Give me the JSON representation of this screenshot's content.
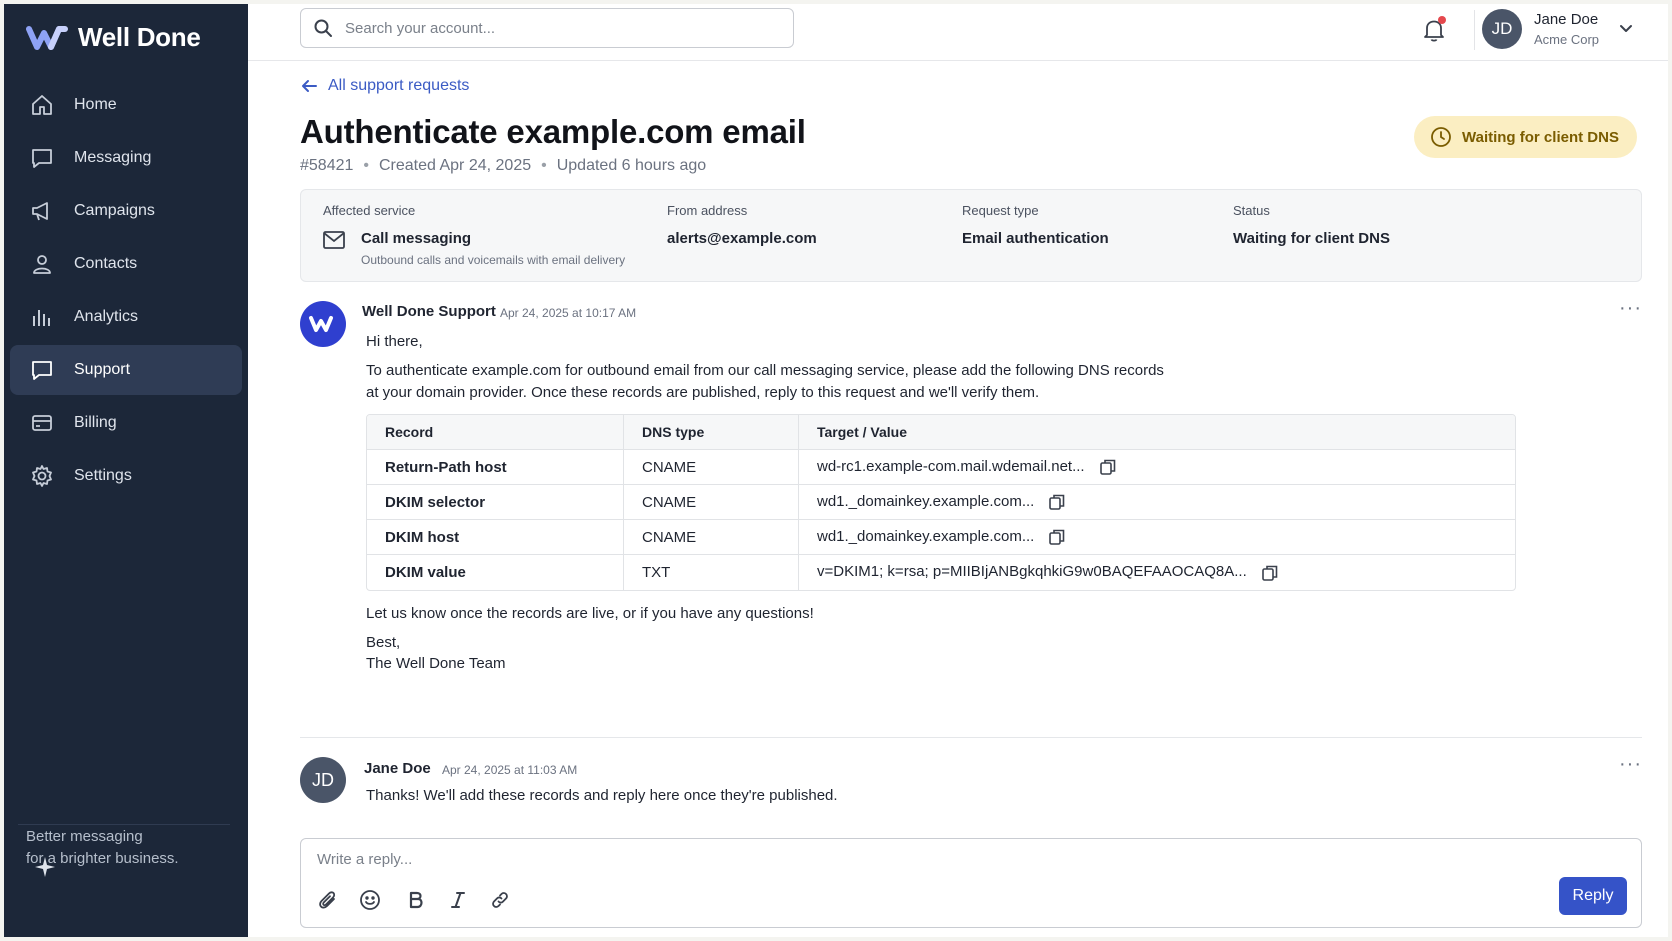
{
  "brand": {
    "name": "Well Done"
  },
  "sidebar": {
    "items": [
      {
        "label": "Home",
        "icon": "home-icon",
        "active": false
      },
      {
        "label": "Messaging",
        "icon": "chat-icon",
        "active": false
      },
      {
        "label": "Campaigns",
        "icon": "megaphone-icon",
        "active": false
      },
      {
        "label": "Contacts",
        "icon": "user-icon",
        "active": false
      },
      {
        "label": "Analytics",
        "icon": "bar-chart-icon",
        "active": false
      },
      {
        "label": "Support",
        "icon": "support-chat-icon",
        "active": true
      },
      {
        "label": "Billing",
        "icon": "card-icon",
        "active": false
      },
      {
        "label": "Settings",
        "icon": "gear-icon",
        "active": false
      }
    ],
    "tagline_line1": "Better messaging",
    "tagline_line2": "for a brighter business."
  },
  "topbar": {
    "search_placeholder": "Search your account...",
    "user": {
      "initials": "JD",
      "name": "Jane Doe",
      "org": "Acme Corp"
    }
  },
  "request": {
    "back_label": "All support requests",
    "title": "Authenticate example.com email",
    "id": "#58421",
    "created": "Created Apr 24, 2025",
    "updated": "Updated 6 hours ago",
    "status_pill": "Waiting for client DNS",
    "status_color": "#fbeec2",
    "summary": {
      "affected_service_label": "Affected service",
      "affected_service": "Call messaging",
      "affected_service_sub": "Outbound calls and voicemails with email delivery",
      "from_label": "From address",
      "from": "alerts@example.com",
      "type_label": "Request type",
      "type": "Email authentication",
      "status_label": "Status",
      "status": "Waiting for client DNS"
    }
  },
  "messages": [
    {
      "author": "Well Done Support",
      "time": "Apr 24, 2025 at 10:17 AM",
      "greeting": "Hi there,",
      "body_line1": "To authenticate example.com for outbound email from our call messaging service, please add the following DNS records",
      "body_line2": "at your domain provider. Once these records are published, reply to this request and we'll verify them.",
      "table": {
        "headers": [
          "Record",
          "DNS type",
          "Target / Value"
        ],
        "rows": [
          [
            "Return-Path host",
            "CNAME",
            "wd-rc1.example-com.mail.wdemail.net..."
          ],
          [
            "DKIM selector",
            "CNAME",
            "wd1._domainkey.example.com..."
          ],
          [
            "DKIM host",
            "CNAME",
            "wd1._domainkey.example.com..."
          ],
          [
            "DKIM value",
            "TXT",
            "v=DKIM1; k=rsa; p=MIIBIjANBgkqhkiG9w0BAQEFAAOCAQ8A..."
          ]
        ]
      },
      "closing": "Let us know once the records are live, or if you have any questions!",
      "signoff1": "Best,",
      "signoff2": "The Well Done Team"
    },
    {
      "author": "Jane Doe",
      "initials": "JD",
      "time": "Apr 24, 2025 at 11:03 AM",
      "body": "Thanks! We'll add these records and reply here once they're published."
    }
  ],
  "reply": {
    "placeholder": "Write a reply...",
    "button": "Reply"
  },
  "colors": {
    "sidebar": "#1c2739",
    "accent": "#3553c8",
    "link": "#3b5bc4"
  }
}
